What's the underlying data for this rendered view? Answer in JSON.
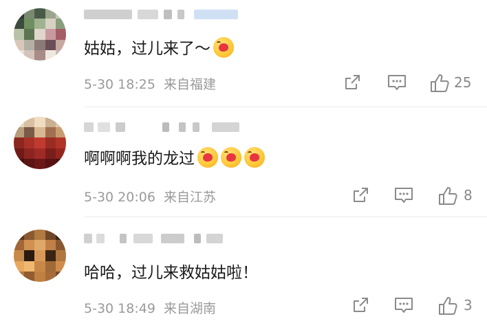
{
  "comments": [
    {
      "text": "姑姑，过儿来了～",
      "emoji_count": 1,
      "time": "5-30 18:25",
      "source": "来自福建",
      "likes": "25",
      "avatar_colors": [
        "#2c3a33",
        "#7a8a70",
        "#4a5a48",
        "#9aa58c",
        "#c4c8b8",
        "#3d4a3e",
        "#6f8f62",
        "#a0b290",
        "#d8d2c4",
        "#8a9d7c",
        "#b7c2a8",
        "#5a7550",
        "#e0d6cc",
        "#c89aa0",
        "#a45e66",
        "#d9c8b8",
        "#b4b0a4",
        "#8c7a78",
        "#6b4f58",
        "#c7a8a0",
        "#e8e0d8",
        "#d4c4bc",
        "#a88c88",
        "#f0e8e0",
        "#cbbab0"
      ]
    },
    {
      "text": "啊啊啊我的龙过",
      "emoji_count": 3,
      "time": "5-30 20:06",
      "source": "来自江苏",
      "likes": "8",
      "avatar_colors": [
        "#e8d8c0",
        "#d8c0a0",
        "#f0dcc0",
        "#c8b090",
        "#e0c8a8",
        "#b89c7c",
        "#7a5a48",
        "#d8b890",
        "#a07050",
        "#c89c70",
        "#8a2820",
        "#a83028",
        "#c03a30",
        "#9a2c24",
        "#b03428",
        "#6e1a18",
        "#8c2420",
        "#a02a26",
        "#7a1e1c",
        "#94261e",
        "#4a1010",
        "#5c1414",
        "#6a1818",
        "#581212",
        "#4e1010"
      ]
    },
    {
      "text": "哈哈，过儿来救姑姑啦！",
      "emoji_count": 0,
      "time": "5-30 18:49",
      "source": "来自湖南",
      "likes": "3",
      "avatar_colors": [
        "#5a3820",
        "#8a5a30",
        "#b07a40",
        "#704628",
        "#3c2818",
        "#a0683a",
        "#d09050",
        "#e0a868",
        "#c08048",
        "#8a5830",
        "#c88a48",
        "#2a1a10",
        "#d89858",
        "#3a2414",
        "#b07840",
        "#e8a860",
        "#f0b870",
        "#c88848",
        "#a06a38",
        "#d08c4c",
        "#b87a40",
        "#905c30",
        "#c08040",
        "#a86c38",
        "#7a4c28"
      ]
    }
  ],
  "icons": [
    "share-icon",
    "comment-icon",
    "like-icon"
  ]
}
